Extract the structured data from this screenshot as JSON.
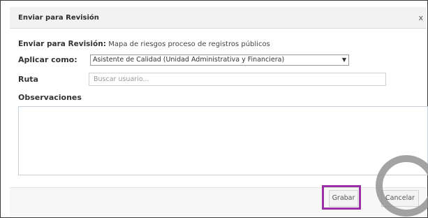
{
  "dialog": {
    "title": "Enviar para Revisión",
    "close_glyph": "x"
  },
  "summary": {
    "label": "Enviar para Revisión:",
    "value": "Mapa de riesgos proceso de registros públicos"
  },
  "apply_as": {
    "label": "Aplicar como:",
    "selected": "Asistente de Calidad (Unidad Administrativa y Financiera)",
    "arrow_glyph": "▼"
  },
  "route": {
    "label": "Ruta",
    "placeholder": "Buscar usuario..."
  },
  "observations": {
    "label": "Observaciones",
    "value": ""
  },
  "footer": {
    "save_label": "Grabar",
    "cancel_label": "Cancelar"
  },
  "highlight_color": "#9b30a6"
}
